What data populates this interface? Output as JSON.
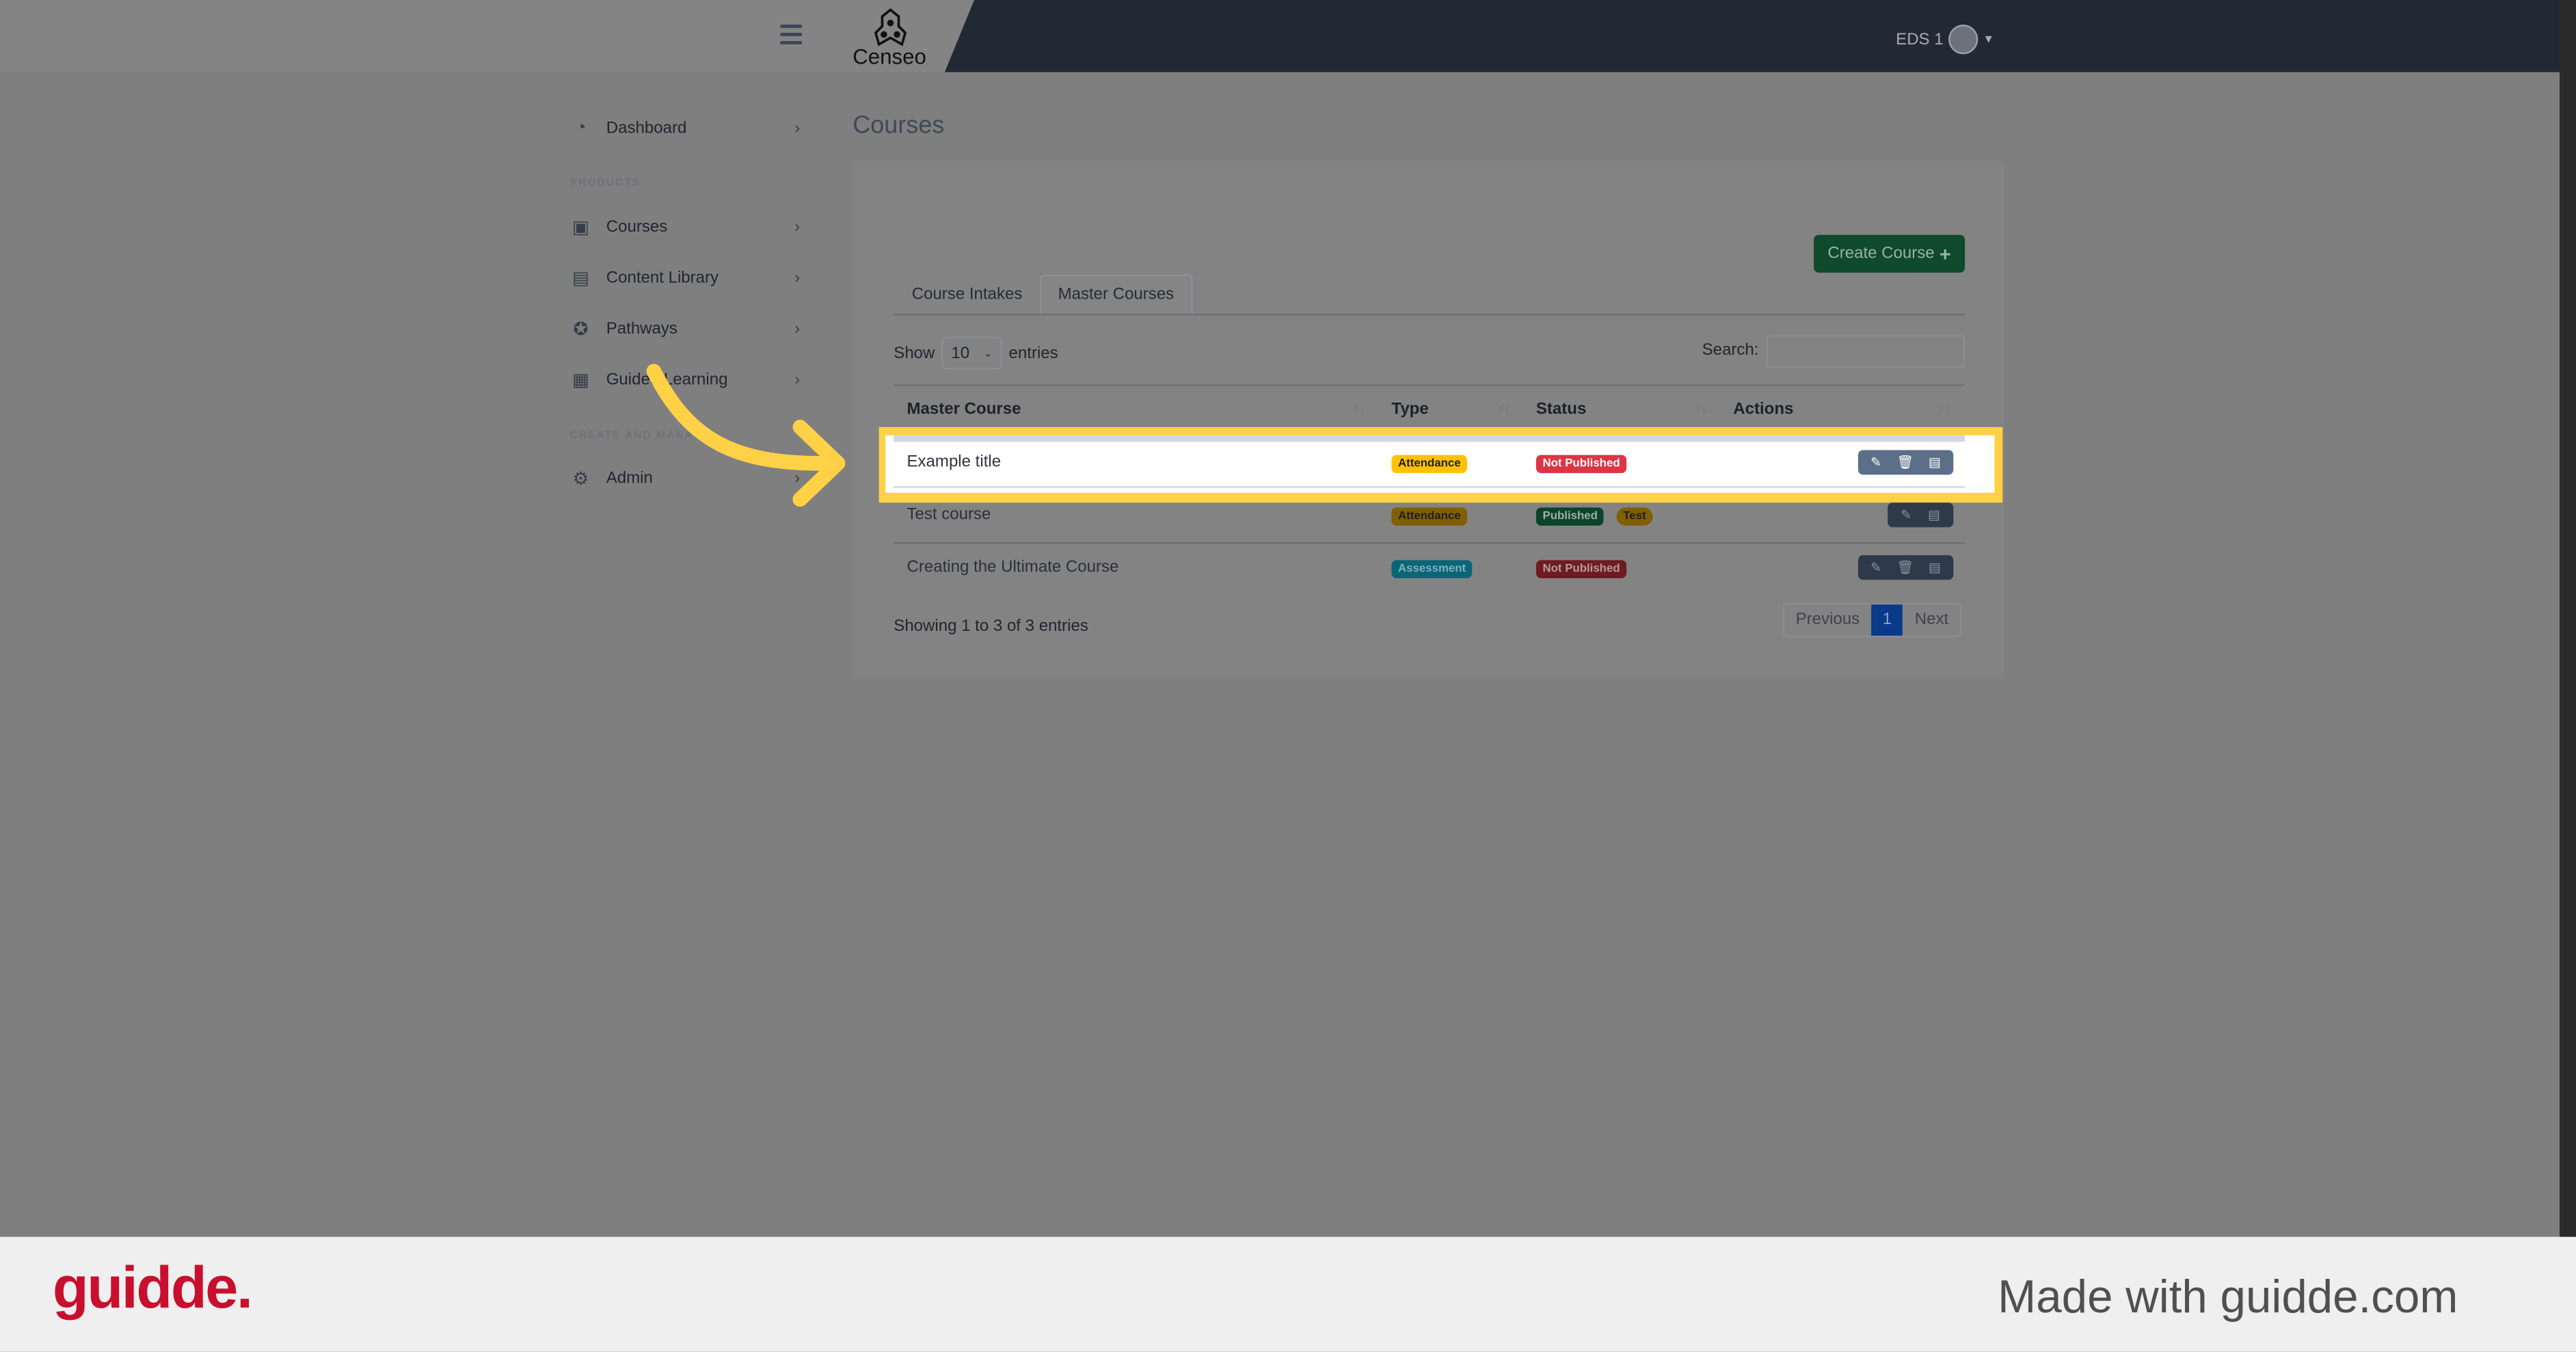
{
  "header": {
    "logo_text": "Censeo",
    "user_label": "EDS 1"
  },
  "sidebar": {
    "items": [
      {
        "label": "Dashboard",
        "icon": "dashboard-gauge-icon"
      },
      {
        "label": "Courses",
        "icon": "chalkboard-teacher-icon"
      },
      {
        "label": "Content Library",
        "icon": "book-icon"
      },
      {
        "label": "Pathways",
        "icon": "award-icon"
      },
      {
        "label": "Guided Learning",
        "icon": "clipboard-list-icon"
      },
      {
        "label": "Admin",
        "icon": "gear-icon"
      }
    ],
    "sections": [
      "PRODUCTS",
      "CREATE AND MANAGE"
    ]
  },
  "main": {
    "title": "Courses",
    "create_button": "Create Course",
    "tabs": [
      {
        "label": "Course Intakes"
      },
      {
        "label": "Master Courses",
        "active": true
      }
    ],
    "show_label": "Show",
    "entries_label": "entries",
    "page_size": "10",
    "search_label": "Search:",
    "search_value": "",
    "columns": [
      "Master Course",
      "Type",
      "Status",
      "Actions"
    ],
    "rows": [
      {
        "title": "Example title",
        "type": "Attendance",
        "status": [
          "Not Published"
        ],
        "actions": [
          "edit",
          "delete",
          "archive"
        ],
        "highlighted": true
      },
      {
        "title": "Test course",
        "type": "Attendance",
        "status": [
          "Published",
          "Test"
        ],
        "actions": [
          "edit",
          "archive"
        ]
      },
      {
        "title": "Creating the Ultimate Course",
        "type": "Assessment",
        "status": [
          "Not Published"
        ],
        "actions": [
          "edit",
          "delete",
          "archive"
        ]
      }
    ],
    "info": "Showing 1 to 3 of 3 entries",
    "pagination": {
      "previous": "Previous",
      "current": "1",
      "next": "Next"
    }
  },
  "footer": {
    "logo": "guidde.",
    "tagline": "Made with guidde.com"
  },
  "colors": {
    "accent_yellow": "#ffd147",
    "attendance": "#ffc107",
    "not_published": "#dc3545",
    "published": "#198754",
    "assessment": "#0dcaf0",
    "guidde_red": "#c8102e"
  }
}
